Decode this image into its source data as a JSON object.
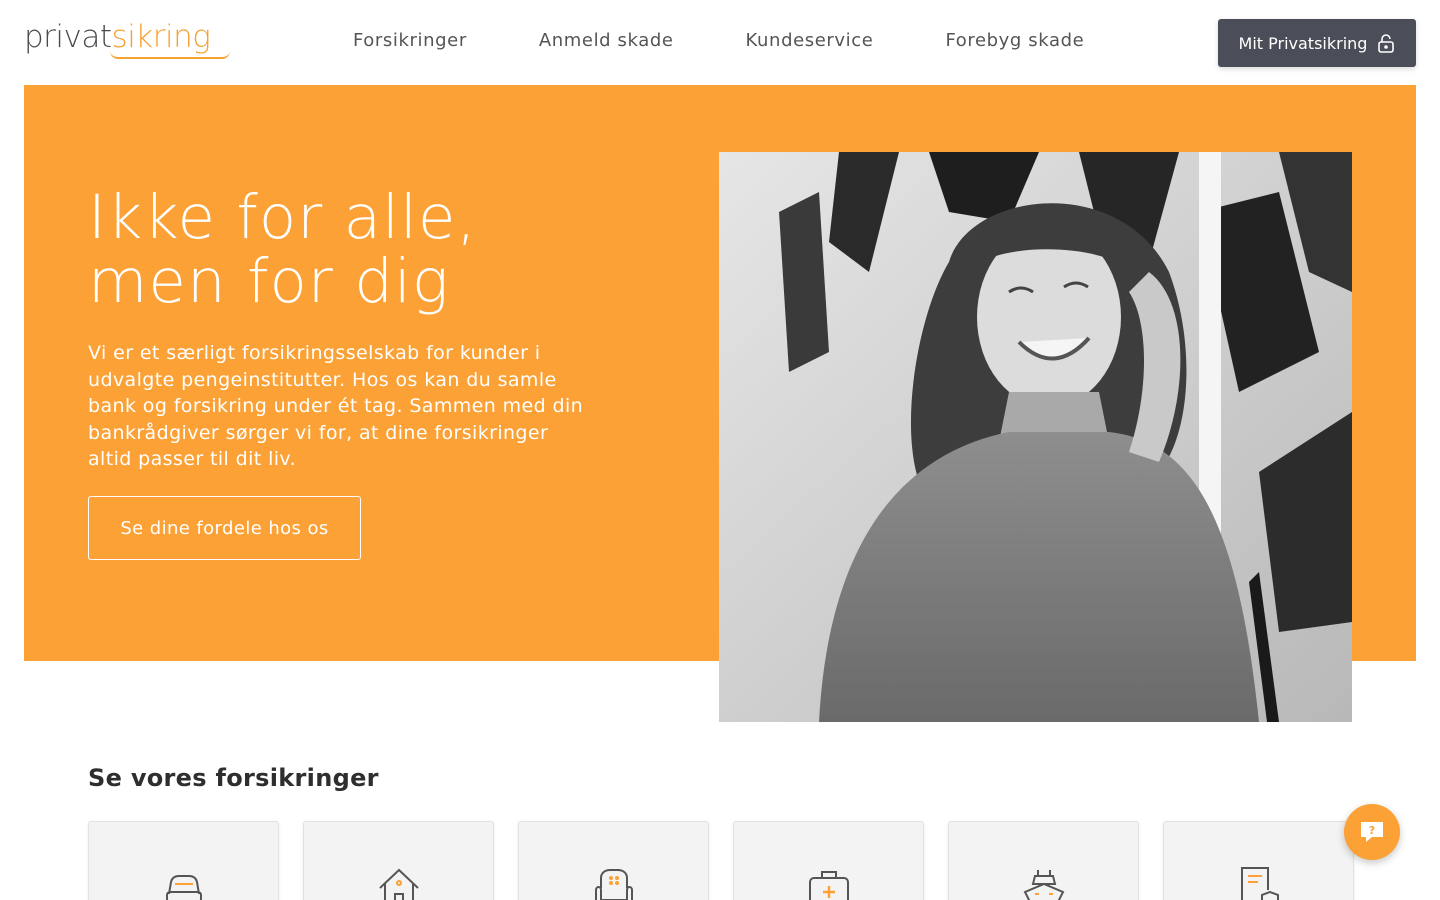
{
  "brand": {
    "logo_part1": "privat",
    "logo_part2": "sikring",
    "accent_color": "#fba135",
    "dark_color": "#4b4e58"
  },
  "nav": {
    "items": [
      {
        "label": "Forsikringer"
      },
      {
        "label": "Anmeld skade"
      },
      {
        "label": "Kundeservice"
      },
      {
        "label": "Forebyg skade"
      }
    ],
    "login_label": "Mit Privatsikring",
    "login_icon": "lock-icon"
  },
  "hero": {
    "title": "Ikke for alle,\nmen for dig",
    "text": "Vi er et særligt forsikringsselskab for kunder i udvalgte pengeinstitutter. Hos os kan du samle bank og forsikring under ét tag. Sammen med din bankrådgiver sørger vi for, at dine forsikringer altid passer til dit liv.",
    "cta_label": "Se dine fordele hos os",
    "image": "smiling-woman-photo"
  },
  "insurances": {
    "title": "Se vores forsikringer",
    "cards": [
      {
        "icon": "car-icon"
      },
      {
        "icon": "house-icon"
      },
      {
        "icon": "armchair-icon"
      },
      {
        "icon": "first-aid-kit-icon"
      },
      {
        "icon": "boat-icon"
      },
      {
        "icon": "document-shield-icon"
      }
    ]
  },
  "chat": {
    "icon": "chat-question-icon"
  }
}
